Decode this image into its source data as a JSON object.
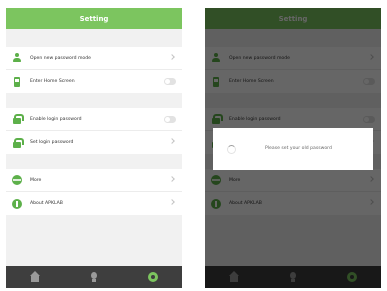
{
  "settings_screen": {
    "title": "Setting",
    "items": [
      {
        "label": "Open new password mode",
        "icon": "person-icon"
      },
      {
        "label": "Enter Home Screen",
        "icon": "phone-icon"
      },
      {
        "label": "Enable login password",
        "icon": "lock-icon"
      },
      {
        "label": "Set login password",
        "icon": "lock-icon"
      },
      {
        "label": "More",
        "icon": "globe-icon"
      },
      {
        "label": "About APKLAB",
        "icon": "info-icon"
      }
    ],
    "nav": [
      {
        "name": "home-tab-icon",
        "active": false
      },
      {
        "name": "tips-tab-icon",
        "active": false
      },
      {
        "name": "settings-tab-icon",
        "active": true
      }
    ]
  },
  "loading_dialog": {
    "message": "Please set your old password"
  },
  "colors": {
    "accent": "#7cc55f",
    "icon_green": "#5db04a",
    "nav_bar": "#3e3e3e",
    "background": "#f1f1f1"
  }
}
